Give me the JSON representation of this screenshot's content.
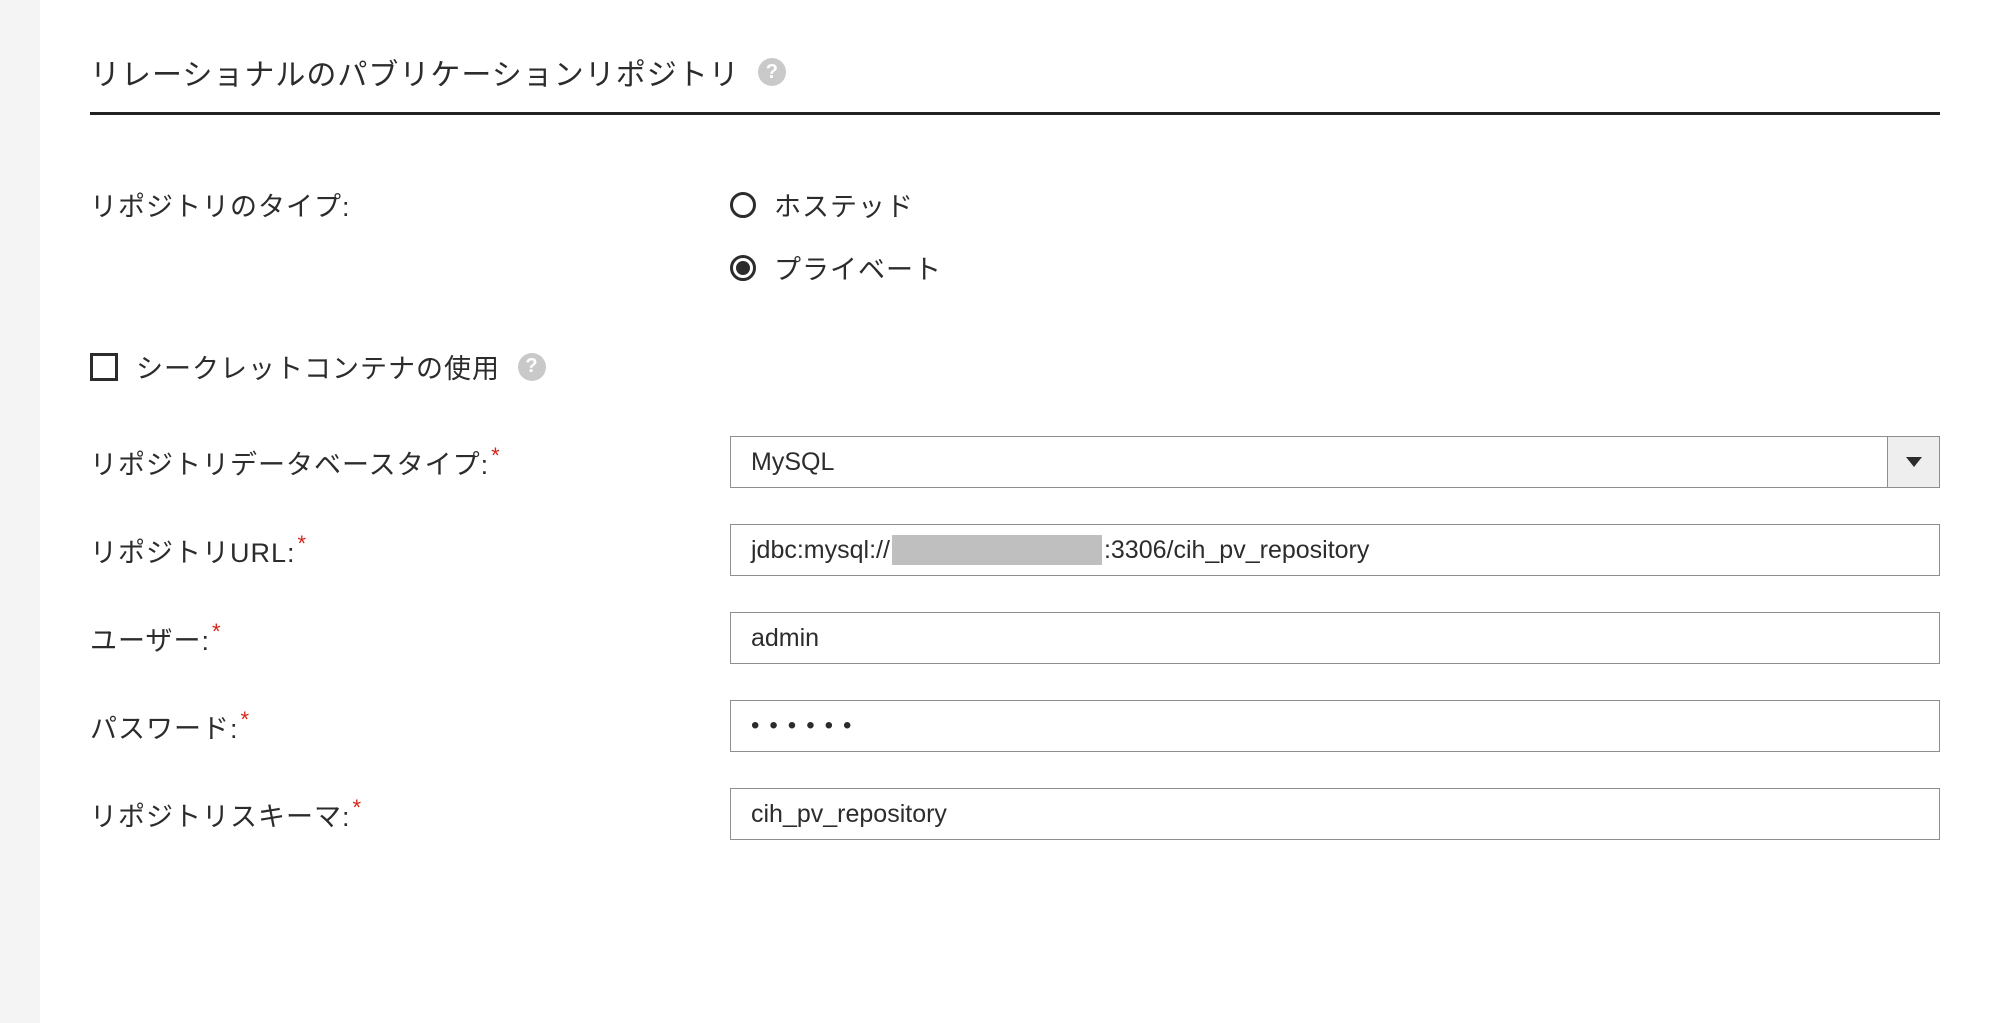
{
  "section": {
    "title": "リレーショナルのパブリケーションリポジトリ"
  },
  "repo_type": {
    "label": "リポジトリのタイプ:",
    "options": {
      "hosted": "ホステッド",
      "private": "プライベート"
    },
    "selected": "private"
  },
  "secret_container": {
    "label": "シークレットコンテナの使用",
    "checked": false
  },
  "db_type": {
    "label": "リポジトリデータベースタイプ:",
    "value": "MySQL"
  },
  "repo_url": {
    "label": "リポジトリURL:",
    "prefix": "jdbc:mysql://",
    "suffix": ":3306/cih_pv_repository"
  },
  "user": {
    "label": "ユーザー:",
    "value": "admin"
  },
  "password": {
    "label": "パスワード:",
    "value": "••••••"
  },
  "schema": {
    "label": "リポジトリスキーマ:",
    "value": "cih_pv_repository"
  },
  "required_marker": "*",
  "help_glyph": "?"
}
